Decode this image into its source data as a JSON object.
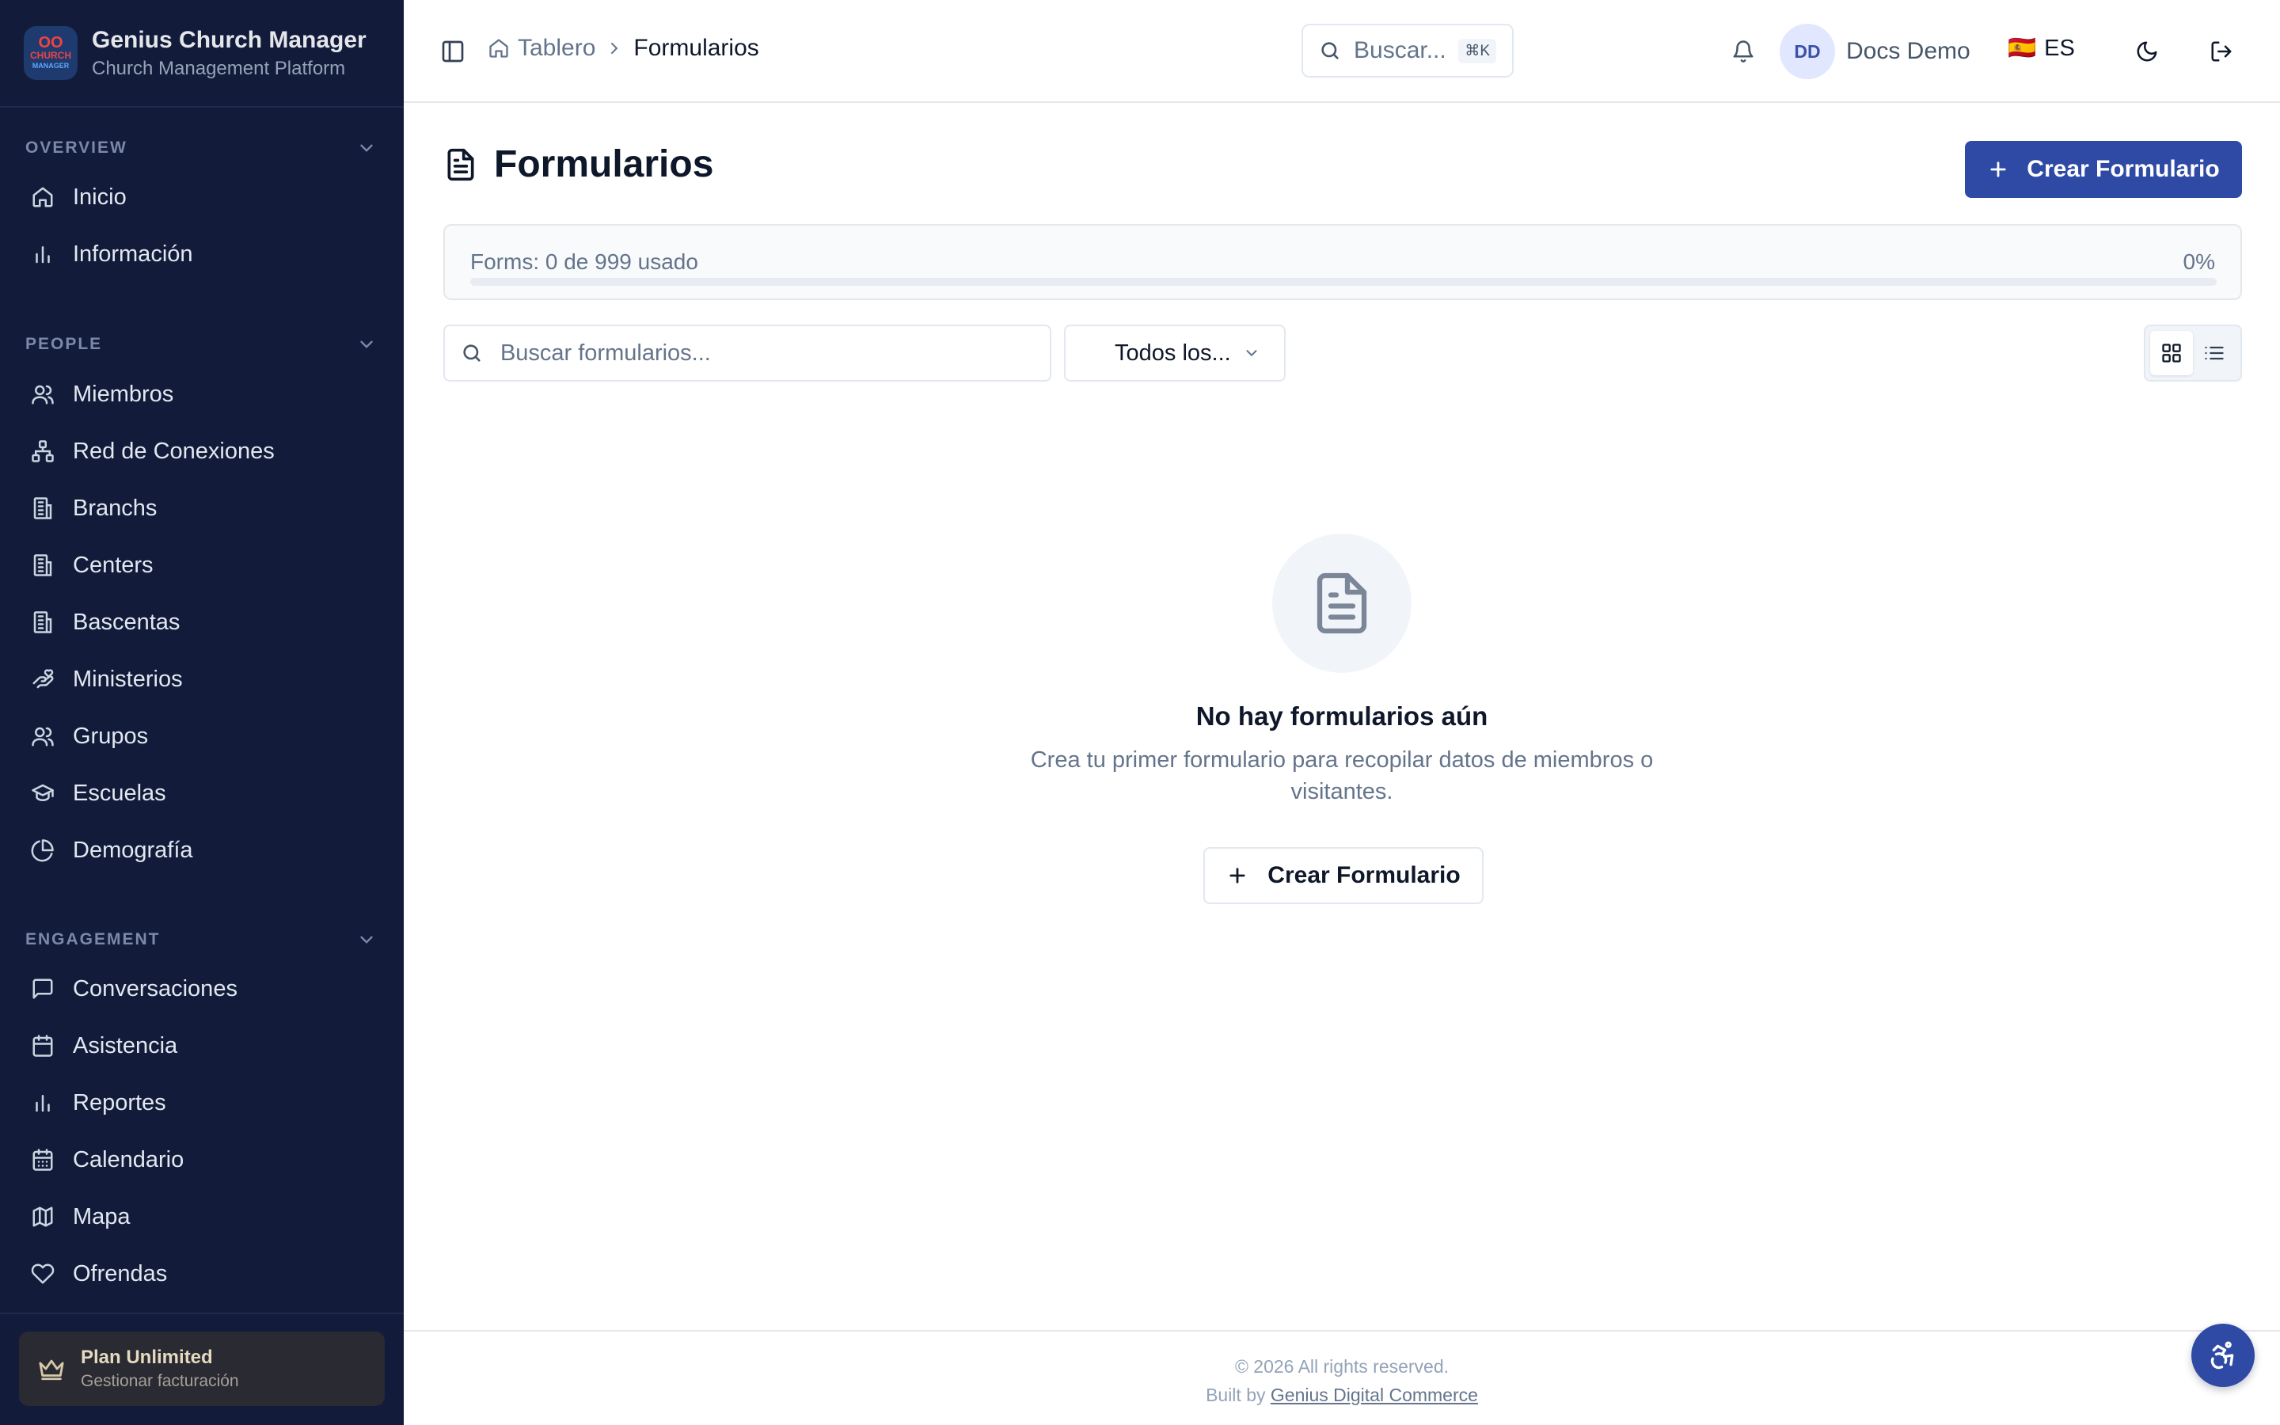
{
  "brand": {
    "logo_top": "OO",
    "logo_mid": "CHURCH",
    "logo_bot": "MANAGER",
    "title": "Genius Church Manager",
    "subtitle": "Church Management Platform"
  },
  "sidebar": {
    "sections": [
      {
        "title": "OVERVIEW",
        "items": [
          {
            "label": "Inicio",
            "icon": "home-icon"
          },
          {
            "label": "Información",
            "icon": "bar-chart-icon"
          }
        ]
      },
      {
        "title": "PEOPLE",
        "items": [
          {
            "label": "Miembros",
            "icon": "users-icon"
          },
          {
            "label": "Red de Conexiones",
            "icon": "network-icon"
          },
          {
            "label": "Branchs",
            "icon": "building-icon"
          },
          {
            "label": "Centers",
            "icon": "building-icon"
          },
          {
            "label": "Bascentas",
            "icon": "building-icon"
          },
          {
            "label": "Ministerios",
            "icon": "hand-heart-icon"
          },
          {
            "label": "Grupos",
            "icon": "users-icon"
          },
          {
            "label": "Escuelas",
            "icon": "graduation-cap-icon"
          },
          {
            "label": "Demografía",
            "icon": "pie-chart-icon"
          }
        ]
      },
      {
        "title": "ENGAGEMENT",
        "items": [
          {
            "label": "Conversaciones",
            "icon": "message-icon"
          },
          {
            "label": "Asistencia",
            "icon": "calendar-icon"
          },
          {
            "label": "Reportes",
            "icon": "bar-chart-icon"
          },
          {
            "label": "Calendario",
            "icon": "calendar-grid-icon"
          },
          {
            "label": "Mapa",
            "icon": "map-icon"
          },
          {
            "label": "Ofrendas",
            "icon": "heart-icon"
          }
        ]
      }
    ],
    "plan": {
      "title": "Plan Unlimited",
      "subtitle": "Gestionar facturación"
    }
  },
  "header": {
    "breadcrumb": {
      "home": "Tablero",
      "current": "Formularios"
    },
    "search": {
      "placeholder": "Buscar...",
      "shortcut": "⌘K"
    },
    "user": {
      "initials": "DD",
      "name": "Docs Demo"
    },
    "language": {
      "flag": "🇪🇸",
      "code": "ES"
    }
  },
  "main": {
    "title": "Formularios",
    "create_button": "Crear Formulario",
    "usage": {
      "label": "Forms: 0 de 999 usado",
      "percent_text": "0%",
      "fraction": 0
    },
    "search_placeholder": "Buscar formularios...",
    "filter": {
      "selected": "Todos los..."
    },
    "empty": {
      "title": "No hay formularios aún",
      "description": "Crea tu primer formulario para recopilar datos de miembros o visitantes.",
      "button": "Crear Formulario"
    }
  },
  "footer": {
    "copyright": "© 2026 All rights reserved.",
    "built_by": "Built by",
    "link": "Genius Digital Commerce"
  },
  "colors": {
    "sidebar_bg": "#121c3a",
    "primary": "#2f4aa5"
  }
}
